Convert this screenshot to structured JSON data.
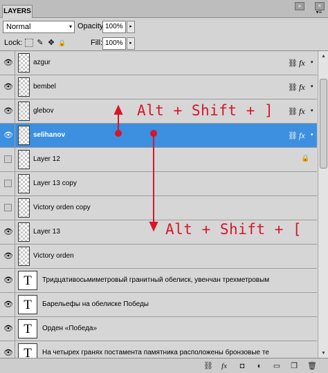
{
  "panel": {
    "tab_label": "LAYERS",
    "collapse_glyph": "»",
    "close_glyph": "×",
    "menu_glyph": "▾≡"
  },
  "controls": {
    "blend_mode": "Normal",
    "opacity_label": "Opacity:",
    "opacity_value": "100%",
    "lock_label": "Lock:",
    "fill_label": "Fill:",
    "fill_value": "100%",
    "dropdown_glyph": "▾",
    "stepper_glyph": "▸",
    "lock_icons": {
      "transparent": "",
      "brush": "✎",
      "move": "✥",
      "lock": "🔒"
    }
  },
  "layers": [
    {
      "name": "azgur",
      "visible": true,
      "kind": "pixel",
      "linked": true,
      "fx": true
    },
    {
      "name": "bembel",
      "visible": true,
      "kind": "pixel",
      "linked": true,
      "fx": true
    },
    {
      "name": "glebov",
      "visible": true,
      "kind": "pixel",
      "linked": true,
      "fx": true
    },
    {
      "name": "selihanov",
      "visible": true,
      "kind": "pixel",
      "linked": true,
      "fx": true,
      "selected": true
    },
    {
      "name": "Layer 12",
      "visible": false,
      "kind": "pixel",
      "locked": true
    },
    {
      "name": "Layer 13 copy",
      "visible": false,
      "kind": "pixel"
    },
    {
      "name": "Victory orden copy",
      "visible": false,
      "kind": "pixel"
    },
    {
      "name": "Layer 13",
      "visible": true,
      "kind": "pixel"
    },
    {
      "name": "Victory orden",
      "visible": true,
      "kind": "pixel"
    },
    {
      "name": "Тридцативосьмиметровый гранитный обелиск, увенчан трехметровым",
      "visible": true,
      "kind": "text"
    },
    {
      "name": "Барельефы на обелиске Победы",
      "visible": true,
      "kind": "text"
    },
    {
      "name": "Орден «Победа»",
      "visible": true,
      "kind": "text"
    },
    {
      "name": "На четырех гранях постамента памятника расположены бронзовые те",
      "visible": true,
      "kind": "text"
    }
  ],
  "layer_icons": {
    "eye": "👁",
    "link": "⛓",
    "fx": "fx",
    "fx_arrow": "▾",
    "lock": "🔒",
    "text_thumb": "T"
  },
  "scrollbar": {
    "up": "▲",
    "down": "▼"
  },
  "bottom_bar": {
    "link": "⛓",
    "fx": "fx",
    "mask": "◘",
    "adjustment": "◐",
    "group": "▭",
    "new_layer": "❐",
    "delete": "🗑"
  },
  "annotations": {
    "up_shortcut": "Alt + Shift + ]",
    "down_shortcut": "Alt + Shift + [",
    "accent_color": "#d8152a"
  }
}
